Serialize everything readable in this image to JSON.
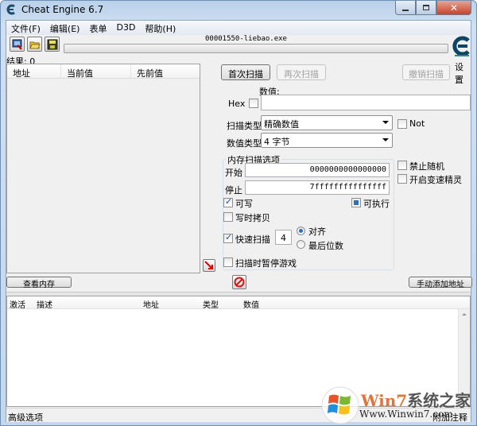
{
  "window": {
    "title": "Cheat Engine 6.7",
    "controls": {
      "minimize": "minimize",
      "maximize": "maximize",
      "close": "close"
    }
  },
  "menu": [
    {
      "label": "文件(F)"
    },
    {
      "label": "编辑(E)"
    },
    {
      "label": "表单"
    },
    {
      "label": "D3D"
    },
    {
      "label": "帮助(H)"
    }
  ],
  "toolbar": {
    "icons": [
      "select-process-icon",
      "open-file-icon",
      "save-icon"
    ],
    "process_name": "00001550-liebao.exe",
    "progress": 0,
    "settings_label": "设置"
  },
  "results": {
    "label": "结果: 0",
    "columns": [
      "地址",
      "当前值",
      "先前值"
    ],
    "rows": []
  },
  "scan": {
    "first_scan": "首次扫描",
    "next_scan": "再次扫描",
    "undo_scan": "撤销扫描",
    "value_label": "数值:",
    "hex_label": "Hex",
    "hex_checked": false,
    "value": "",
    "scan_type_label": "扫描类型",
    "scan_type_value": "精确数值",
    "not_label": "Not",
    "not_checked": false,
    "value_type_label": "数值类型",
    "value_type_value": "4 字节"
  },
  "memory_options": {
    "title": "内存扫描选项",
    "start_label": "开始",
    "start_value": "0000000000000000",
    "stop_label": "停止",
    "stop_value": "7fffffffffffffff",
    "writable_label": "可写",
    "writable_checked": true,
    "executable_label": "可执行",
    "executable_state": "indeterminate",
    "copy_on_write_label": "写时拷贝",
    "copy_on_write_checked": false,
    "fast_scan_label": "快速扫描",
    "fast_scan_checked": true,
    "fast_scan_value": "4",
    "align_label": "对齐",
    "last_digits_label": "最后位数",
    "align_selected": "对齐",
    "pause_label": "扫描时暂停游戏",
    "pause_checked": false
  },
  "extra_options": {
    "disable_random_label": "禁止随机",
    "disable_random_checked": false,
    "speedhack_label": "开启变速精灵",
    "speedhack_checked": false
  },
  "bottom": {
    "view_memory": "查看内存",
    "add_address": "手动添加地址"
  },
  "address_list": {
    "columns": [
      "激活",
      "描述",
      "地址",
      "类型",
      "数值"
    ],
    "rows": []
  },
  "statusbar": {
    "left": "高级选项",
    "right": "附加注释"
  },
  "watermark": {
    "title_latin": "Win7",
    "title_cn": "系统之家",
    "url": "Www.Winwin7.com"
  }
}
